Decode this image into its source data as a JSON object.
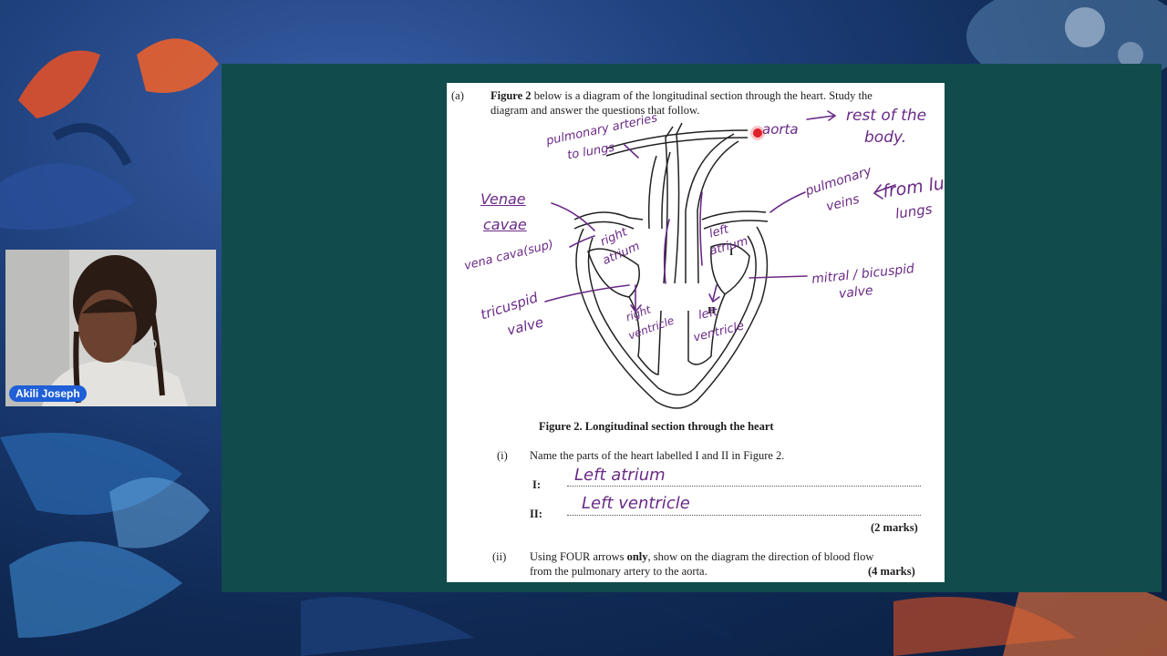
{
  "presenter": {
    "name": "Akili Joseph"
  },
  "document": {
    "part_label": "(a)",
    "intro_bold": "Figure 2",
    "intro_rest_line1": " below is a diagram of the longitudinal section through the heart.  Study the",
    "intro_line2": "diagram and answer the questions that follow.",
    "figure_caption": "Figure 2. Longitudinal section through the heart",
    "diagram_label_I": "I",
    "diagram_label_II": "II",
    "q1_num": "(i)",
    "q1_text": "Name the parts of the heart labelled I and II in Figure 2.",
    "q1_label_I": "I:",
    "q1_label_II": "II:",
    "q1_marks": "(2 marks)",
    "q2_num": "(ii)",
    "q2_line1_a": "Using FOUR arrows ",
    "q2_line1_bold": "only",
    "q2_line1_b": ", show on the diagram the direction of blood flow",
    "q2_line2": "from the pulmonary artery to the aorta.",
    "q2_marks": "(4 marks)"
  },
  "handwriting": {
    "pulmonary_arteries": "pulmonary arteries",
    "to_lungs": "to lungs",
    "aorta": "aorta",
    "rest_of_the": "rest of the",
    "body": "body.",
    "venae": "Venae",
    "cavae": "cavae",
    "vena_cava_sup": "vena cava(sup)",
    "tricuspid": "tricuspid",
    "valve": "valve",
    "right_atrium_1": "right",
    "right_atrium_2": "atrium",
    "right_ventricle_1": "right",
    "right_ventricle_2": "ventricle",
    "left_atrium_1": "left",
    "left_atrium_2": "atrium",
    "left_ventricle_1": "left",
    "left_ventricle_2": "ventricle",
    "pulmonary": "pulmonary",
    "veins": "veins",
    "from_lungs_1": "from lu",
    "from_lungs_2": "lungs",
    "mitral": "mitral / bicuspid",
    "mitral_valve": "valve",
    "answer_I": "Left atrium",
    "answer_II": "Left ventricle"
  },
  "colors": {
    "stage": "#114b4b",
    "ink": "#6a2a86",
    "badge": "#1f5fd8",
    "pointer": "#e0202a"
  }
}
